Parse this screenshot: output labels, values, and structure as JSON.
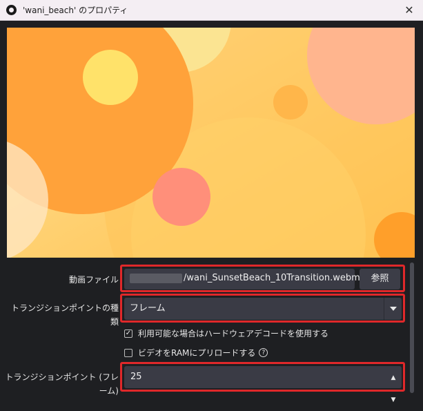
{
  "window": {
    "title": "'wani_beach' のプロパティ",
    "close_glyph": "✕"
  },
  "form": {
    "video_file": {
      "label": "動画ファイル",
      "value": "/wani_SunsetBeach_10Transition.webm",
      "browse_label": "参照"
    },
    "transition_point_type": {
      "label": "トランジションポイントの種類",
      "value": "フレーム"
    },
    "hardware_decode": {
      "label": "利用可能な場合はハードウェアデコードを使用する",
      "checked": true,
      "check_glyph": "✓"
    },
    "preload_ram": {
      "label": "ビデオをRAMにプリロードする",
      "checked": false,
      "help_glyph": "?"
    },
    "transition_point": {
      "label": "トランジションポイント (フレーム)",
      "value": "25",
      "up_glyph": "▲",
      "down_glyph": "▼"
    }
  },
  "colors": {
    "highlight": "#e0282a",
    "field_bg": "#3a3b45",
    "dialog_bg": "#1e1f22"
  }
}
